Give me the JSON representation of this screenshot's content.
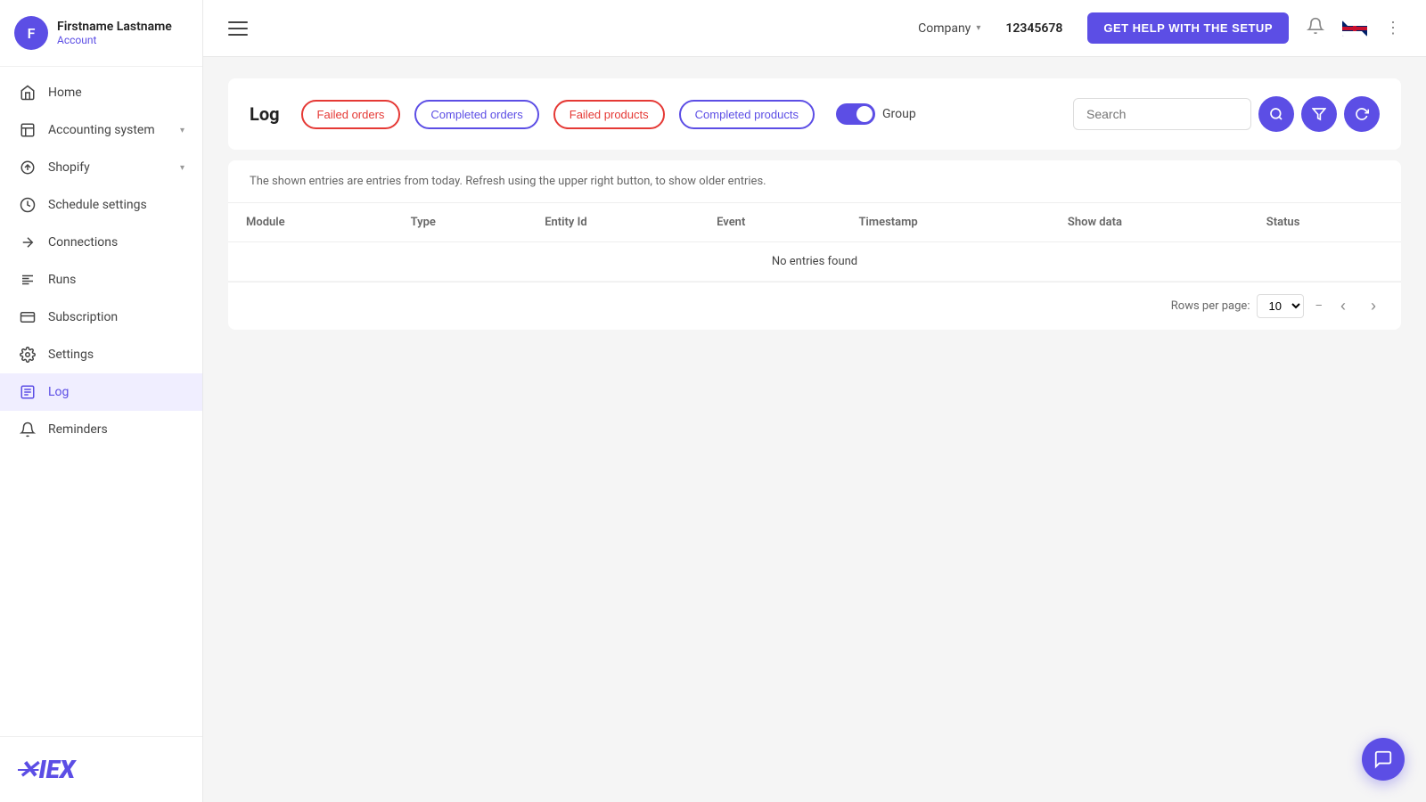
{
  "sidebar": {
    "user": {
      "initial": "F",
      "name": "Firstname Lastname",
      "account_label": "Account"
    },
    "items": [
      {
        "id": "home",
        "label": "Home",
        "icon": "home",
        "active": false
      },
      {
        "id": "accounting-system",
        "label": "Accounting system",
        "icon": "building",
        "active": false,
        "has_chevron": true
      },
      {
        "id": "shopify",
        "label": "Shopify",
        "icon": "shopify",
        "active": false,
        "has_chevron": true
      },
      {
        "id": "schedule-settings",
        "label": "Schedule settings",
        "icon": "clock",
        "active": false
      },
      {
        "id": "connections",
        "label": "Connections",
        "icon": "connections",
        "active": false
      },
      {
        "id": "runs",
        "label": "Runs",
        "icon": "runs",
        "active": false
      },
      {
        "id": "subscription",
        "label": "Subscription",
        "icon": "subscription",
        "active": false
      },
      {
        "id": "settings",
        "label": "Settings",
        "icon": "settings",
        "active": false
      },
      {
        "id": "log",
        "label": "Log",
        "icon": "log",
        "active": true
      },
      {
        "id": "reminders",
        "label": "Reminders",
        "icon": "bell",
        "active": false
      }
    ],
    "logo": "✕IEX"
  },
  "topbar": {
    "company_label": "Company",
    "account_id": "12345678",
    "get_help_label": "GET HELP WITH THE SETUP",
    "notification_icon": "🔔"
  },
  "log_page": {
    "title": "Log",
    "filters": [
      {
        "id": "failed-orders",
        "label": "Failed orders",
        "style": "red-active"
      },
      {
        "id": "completed-orders",
        "label": "Completed orders",
        "style": "blue-outline"
      },
      {
        "id": "failed-products",
        "label": "Failed products",
        "style": "red-active"
      },
      {
        "id": "completed-products",
        "label": "Completed products",
        "style": "blue-outline"
      }
    ],
    "group_label": "Group",
    "group_enabled": true,
    "search_placeholder": "Search",
    "info_text": "The shown entries are entries from today. Refresh using the upper right button, to show older entries.",
    "table": {
      "columns": [
        "Module",
        "Type",
        "Entity Id",
        "Event",
        "Timestamp",
        "Show data",
        "Status"
      ],
      "empty_message": "No entries found"
    },
    "pagination": {
      "rows_per_page_label": "Rows per page:",
      "rows_per_page_value": "10",
      "page_range": "–"
    }
  }
}
